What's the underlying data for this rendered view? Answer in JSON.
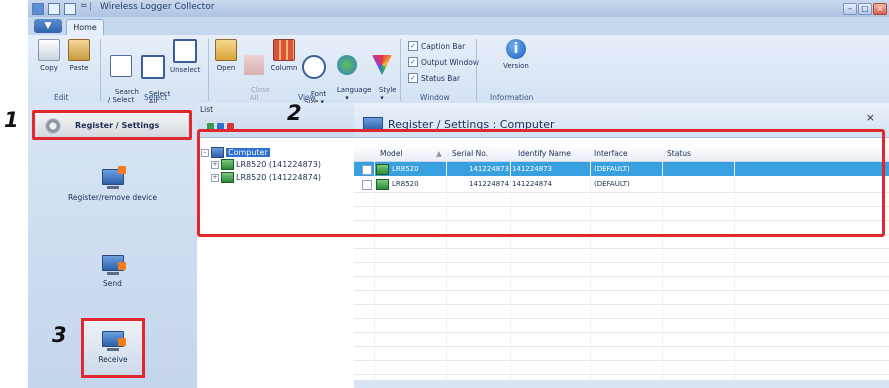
{
  "window": {
    "title": "Wireless Logger Collector"
  },
  "tabs": {
    "app_menu": "▼",
    "home": "Home"
  },
  "ribbon": {
    "edit": {
      "label": "Edit",
      "copy": "Copy",
      "paste": "Paste"
    },
    "select": {
      "label": "Select",
      "search": "Search\n/ Select",
      "select_all": "Select\nAll",
      "unselect": "Unselect"
    },
    "view": {
      "label": "View",
      "open": "Open",
      "close_all": "Close\nAll",
      "column": "Column",
      "font_size": "Font\nSize ▾",
      "language": "Language\n▾",
      "style": "Style\n▾"
    },
    "window": {
      "label": "Window",
      "caption_bar": "Caption Bar",
      "output_window": "Output Window",
      "status_bar": "Status Bar"
    },
    "information": {
      "label": "Information",
      "version": "Version"
    }
  },
  "sidebar": {
    "register_settings": "Register / Settings",
    "register_remove": "Register/remove device",
    "send": "Send",
    "receive": "Receive"
  },
  "tree": {
    "header": "List",
    "computer": "Computer",
    "devices": [
      "LR8520 (141224873)",
      "LR8520 (141224874)"
    ]
  },
  "main": {
    "title": "Register / Settings : Computer",
    "close": "×",
    "columns": [
      "Model",
      "Serial No.",
      "Identify Name",
      "Interface",
      "Status"
    ],
    "rows": [
      {
        "model": "LR8520",
        "serial": "141224873",
        "name": "141224873",
        "interface": "(DEFAULT)",
        "status": "",
        "selected": true
      },
      {
        "model": "LR8520",
        "serial": "141224874",
        "name": "141224874",
        "interface": "(DEFAULT)",
        "status": "",
        "selected": false
      }
    ]
  },
  "steps": [
    "1",
    "2",
    "3"
  ]
}
